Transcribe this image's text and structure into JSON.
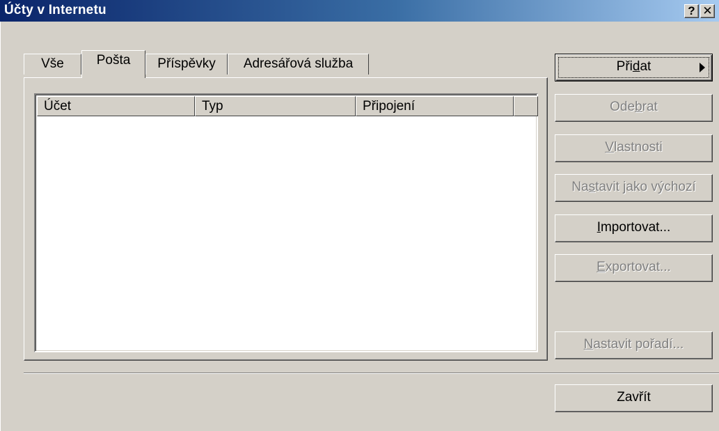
{
  "window": {
    "title": "Účty v Internetu",
    "help_label": "?",
    "close_label": "✕"
  },
  "tabs": [
    {
      "label": "Vše"
    },
    {
      "label": "Pošta"
    },
    {
      "label": "Příspěvky"
    },
    {
      "label": "Adresářová služba"
    }
  ],
  "list": {
    "columns": [
      "Účet",
      "Typ",
      "Připojení",
      ""
    ],
    "rows": []
  },
  "buttons": {
    "add": {
      "pre": "Při",
      "u": "d",
      "post": "at"
    },
    "remove": {
      "pre": "Ode",
      "u": "b",
      "post": "rat"
    },
    "properties": {
      "pre": "",
      "u": "V",
      "post": "lastnosti"
    },
    "set_default": {
      "pre": "Na",
      "u": "s",
      "post": "tavit jako výchozí"
    },
    "import": {
      "pre": "",
      "u": "I",
      "post": "mportovat..."
    },
    "export": {
      "pre": "",
      "u": "E",
      "post": "xportovat..."
    },
    "set_order": {
      "pre": "",
      "u": "N",
      "post": "astavit pořadí..."
    },
    "close": "Zavřít"
  }
}
